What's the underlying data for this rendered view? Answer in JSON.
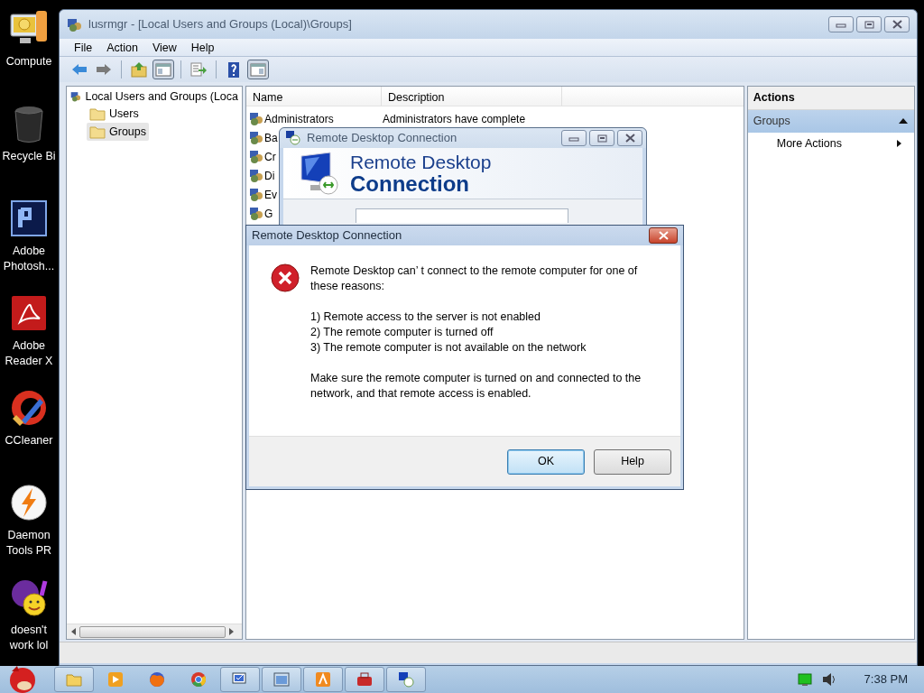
{
  "desktop_icons": [
    {
      "kind": "computer",
      "label": "Compute"
    },
    {
      "kind": "bin",
      "label": "Recycle Bi"
    },
    {
      "kind": "photoshop",
      "label": "Adobe Photosh..."
    },
    {
      "kind": "reader",
      "label": "Adobe Reader X"
    },
    {
      "kind": "cleaner",
      "label": "CCleaner"
    },
    {
      "kind": "daemon",
      "label": "Daemon Tools PR"
    },
    {
      "kind": "messenger",
      "label": "doesn't work lol"
    }
  ],
  "main_window": {
    "title": "lusrmgr - [Local Users and Groups (Local)\\Groups]",
    "menu": [
      "File",
      "Action",
      "View",
      "Help"
    ],
    "toolbar": [
      {
        "kind": "back",
        "pressed": false
      },
      {
        "kind": "forward",
        "pressed": false
      },
      {
        "kind": "up",
        "pressed": false
      },
      {
        "kind": "tree",
        "pressed": true
      },
      {
        "kind": "export",
        "pressed": false
      },
      {
        "kind": "help",
        "pressed": false
      },
      {
        "kind": "pane",
        "pressed": true
      }
    ],
    "tree": {
      "label": "Local Users and Groups (Loca",
      "children": [
        {
          "label": "Users",
          "selected": false
        },
        {
          "label": "Groups",
          "selected": true
        }
      ]
    },
    "list": {
      "columns": [
        "Name",
        "Description"
      ],
      "rows": [
        {
          "name": "Administrators",
          "description": "Administrators have complete"
        },
        {
          "name": "Ba"
        },
        {
          "name": "Cr"
        },
        {
          "name": "Di"
        },
        {
          "name": "Ev"
        },
        {
          "name": "G"
        }
      ]
    },
    "actions": {
      "title": "Actions",
      "sections": [
        {
          "label": "Groups",
          "expanded": true,
          "items": [
            "More Actions"
          ]
        }
      ]
    }
  },
  "rdc_window": {
    "title": "Remote Desktop Connection",
    "banner_line_1": "Remote Desktop",
    "banner_line_2": "Connection"
  },
  "error_dialog": {
    "title": "Remote Desktop Connection",
    "message": "Remote Desktop can’ t connect to the remote computer for one of these reasons:",
    "reasons": [
      "1) Remote access to the server is not enabled",
      "2) The remote computer is turned off",
      "3) The remote computer is not available on the network"
    ],
    "advice": "Make sure the remote computer is turned on and connected to the network, and that remote access is enabled.",
    "buttons": [
      {
        "label": "OK",
        "default": true
      },
      {
        "label": "Help",
        "default": false
      }
    ]
  },
  "taskbar": {
    "items": [
      {
        "kind": "folder",
        "running": true
      },
      {
        "kind": "media",
        "running": false
      },
      {
        "kind": "firefox",
        "running": false
      },
      {
        "kind": "chrome",
        "running": false
      },
      {
        "kind": "users",
        "running": true
      },
      {
        "kind": "window",
        "running": true
      },
      {
        "kind": "app",
        "running": true
      },
      {
        "kind": "toolbox",
        "running": true
      },
      {
        "kind": "rdc",
        "running": true
      }
    ],
    "clock": "7:38 PM"
  }
}
